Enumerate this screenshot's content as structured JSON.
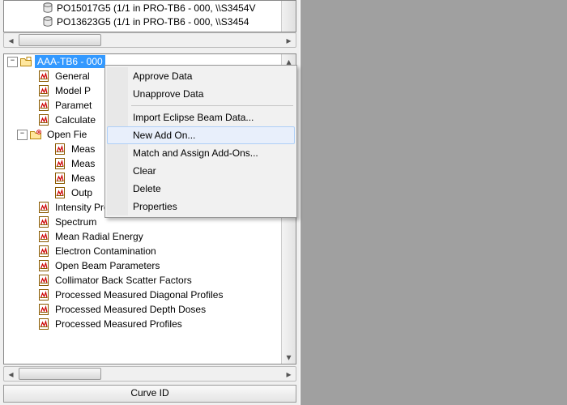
{
  "top_list": {
    "items": [
      "PO15017G5 (1/1 in PRO-TB6 - 000, \\\\S3454V",
      "PO13623G5 (1/1 in PRO-TB6 - 000, \\\\S3454"
    ]
  },
  "tree": {
    "root": {
      "label": "AAA-TB6 - 000",
      "selected": true
    },
    "children": [
      {
        "label": "General"
      },
      {
        "label": "Model P"
      },
      {
        "label": "Paramet"
      },
      {
        "label": "Calculate"
      }
    ],
    "open_field": {
      "label": "Open Fie",
      "children": [
        {
          "label": "Meas"
        },
        {
          "label": "Meas"
        },
        {
          "label": "Meas"
        },
        {
          "label": "Outp"
        }
      ]
    },
    "rest": [
      {
        "label": "Intensity Profile"
      },
      {
        "label": "Spectrum"
      },
      {
        "label": "Mean Radial Energy"
      },
      {
        "label": "Electron Contamination"
      },
      {
        "label": "Open Beam Parameters"
      },
      {
        "label": "Collimator Back Scatter Factors"
      },
      {
        "label": "Processed Measured Diagonal Profiles"
      },
      {
        "label": "Processed Measured Depth Doses"
      },
      {
        "label": "Processed Measured Profiles"
      }
    ]
  },
  "context_menu": {
    "items": [
      {
        "label": "Approve Data"
      },
      {
        "label": "Unapprove Data"
      },
      {
        "sep": true
      },
      {
        "label": "Import Eclipse Beam Data..."
      },
      {
        "label": "New Add On...",
        "hover": true
      },
      {
        "label": "Match and Assign Add-Ons..."
      },
      {
        "label": "Clear"
      },
      {
        "label": "Delete"
      },
      {
        "label": "Properties"
      }
    ]
  },
  "footer": {
    "curve_id_label": "Curve ID"
  }
}
